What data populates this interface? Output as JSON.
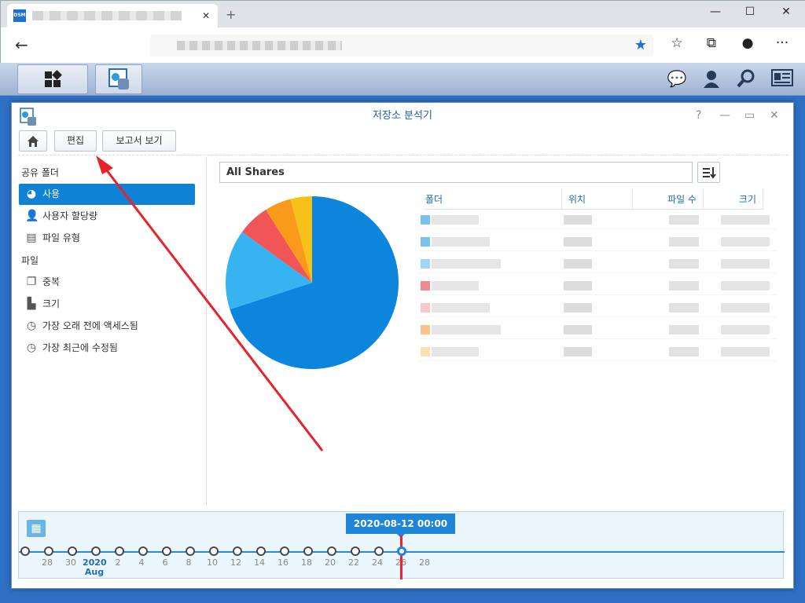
{
  "browser": {
    "tab": {
      "favicon": "DSM",
      "close": "✕"
    },
    "new_tab": "+",
    "window_buttons": {
      "minimize": "—",
      "maximize": "☐",
      "close": "✕"
    },
    "back": "←",
    "star": "★",
    "toolbar_icons": [
      "collections-star-icon",
      "collections-icon",
      "profile-icon",
      "more-icon"
    ],
    "more": "···"
  },
  "window": {
    "title": "저장소 분석기",
    "help": "?",
    "minimize": "—",
    "maximize": "▭",
    "close": "✕"
  },
  "toolbar": {
    "edit": "편집",
    "view_report": "보고서 보기"
  },
  "sidebar": {
    "section_shared": "공유 폴더",
    "section_files": "파일",
    "items_shared": [
      {
        "label": "사용",
        "icon": "pie-chart-icon",
        "selected": true
      },
      {
        "label": "사용자 할당량",
        "icon": "user-icon"
      },
      {
        "label": "파일 유형",
        "icon": "file-icon"
      }
    ],
    "items_files": [
      {
        "label": "중복",
        "icon": "duplicate-icon"
      },
      {
        "label": "크기",
        "icon": "size-icon"
      },
      {
        "label": "가장 오래 전에 액세스됨",
        "icon": "clock-icon"
      },
      {
        "label": "가장 최근에 수정됨",
        "icon": "clock-icon"
      }
    ]
  },
  "filter": {
    "value": "All Shares"
  },
  "table": {
    "headers": [
      "폴더",
      "위치",
      "파일 수",
      "크기"
    ]
  },
  "chart_data": {
    "type": "pie",
    "slices": [
      {
        "value": 70,
        "color": "#0b86dc"
      },
      {
        "value": 15,
        "color": "#36b4f2"
      },
      {
        "value": 6,
        "color": "#f25557"
      },
      {
        "value": 5,
        "color": "#f99a1b"
      },
      {
        "value": 4,
        "color": "#f6c21a"
      }
    ]
  },
  "timeline": {
    "current": "2020-08-12 00:00",
    "ticks": [
      "28",
      "30",
      "2020",
      "2",
      "4",
      "6",
      "8",
      "10",
      "12",
      "14",
      "16",
      "18",
      "20",
      "22",
      "24",
      "26",
      "28"
    ],
    "month_label": "Aug"
  }
}
